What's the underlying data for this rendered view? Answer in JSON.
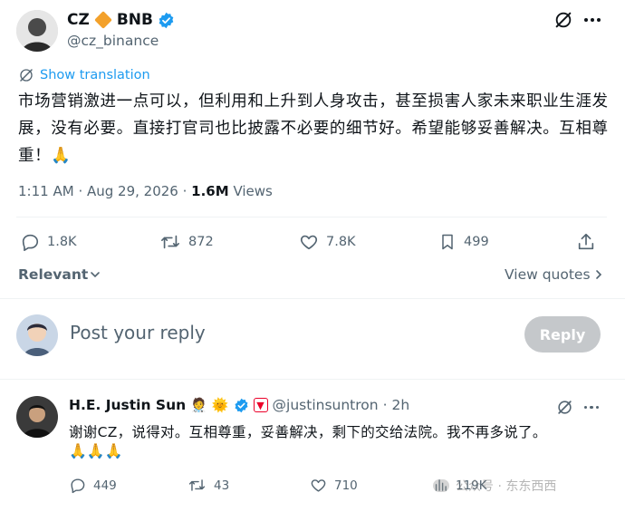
{
  "tweet": {
    "author_name_1": "CZ",
    "author_name_2": "BNB",
    "handle": "@cz_binance",
    "show_translation": "Show translation",
    "text": "市场营销激进一点可以，但利用和上升到人身攻击，甚至损害人家未来职业生涯发展，没有必要。直接打官司也比披露不必要的细节好。希望能够妥善解决。互相尊重！🙏",
    "time": "1:11 AM",
    "date": "Aug 29, 2026",
    "views_count": "1.6M",
    "views_label": "Views",
    "replies": "1.8K",
    "retweets": "872",
    "likes": "7.8K",
    "bookmarks": "499"
  },
  "sort": {
    "relevant": "Relevant",
    "view_quotes": "View quotes"
  },
  "composer": {
    "placeholder": "Post your reply",
    "reply_label": "Reply"
  },
  "reply": {
    "name": "H.E. Justin Sun",
    "handle": "@justinsuntron",
    "time": "2h",
    "text": "谢谢CZ，说得对。互相尊重，妥善解决，剩下的交给法院。我不再多说了。",
    "emoji": "🙏🙏🙏",
    "replies": "449",
    "retweets": "43",
    "likes": "710",
    "views": "119K"
  },
  "watermark": "公众号 · 东东西西",
  "colors": {
    "accent": "#1d9bf0",
    "text": "#0f1419",
    "muted": "#536471",
    "diamond": "#f3a12b",
    "tron_red": "#eb0029"
  }
}
